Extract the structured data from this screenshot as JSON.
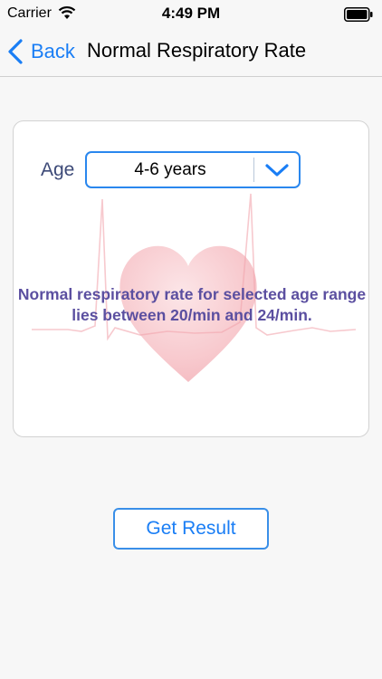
{
  "status_bar": {
    "carrier": "Carrier",
    "time": "4:49 PM",
    "wifi_icon": "wifi-icon",
    "battery_icon": "battery-icon"
  },
  "nav": {
    "back_label": "Back",
    "back_icon": "chevron-left-icon",
    "title": "Normal Respiratory Rate"
  },
  "form": {
    "age_label": "Age",
    "age_selected": "4-6 years",
    "dropdown_icon": "chevron-down-icon",
    "background_icon": "heart-ecg-icon"
  },
  "result": {
    "text": "Normal respiratory rate for selected age range lies between  20/min and 24/min."
  },
  "actions": {
    "get_result_label": "Get Result"
  },
  "colors": {
    "accent": "#1a7ef5",
    "result_text": "#5b4fa0",
    "label_text": "#3d4a78",
    "heart": "#f3a9b0"
  }
}
